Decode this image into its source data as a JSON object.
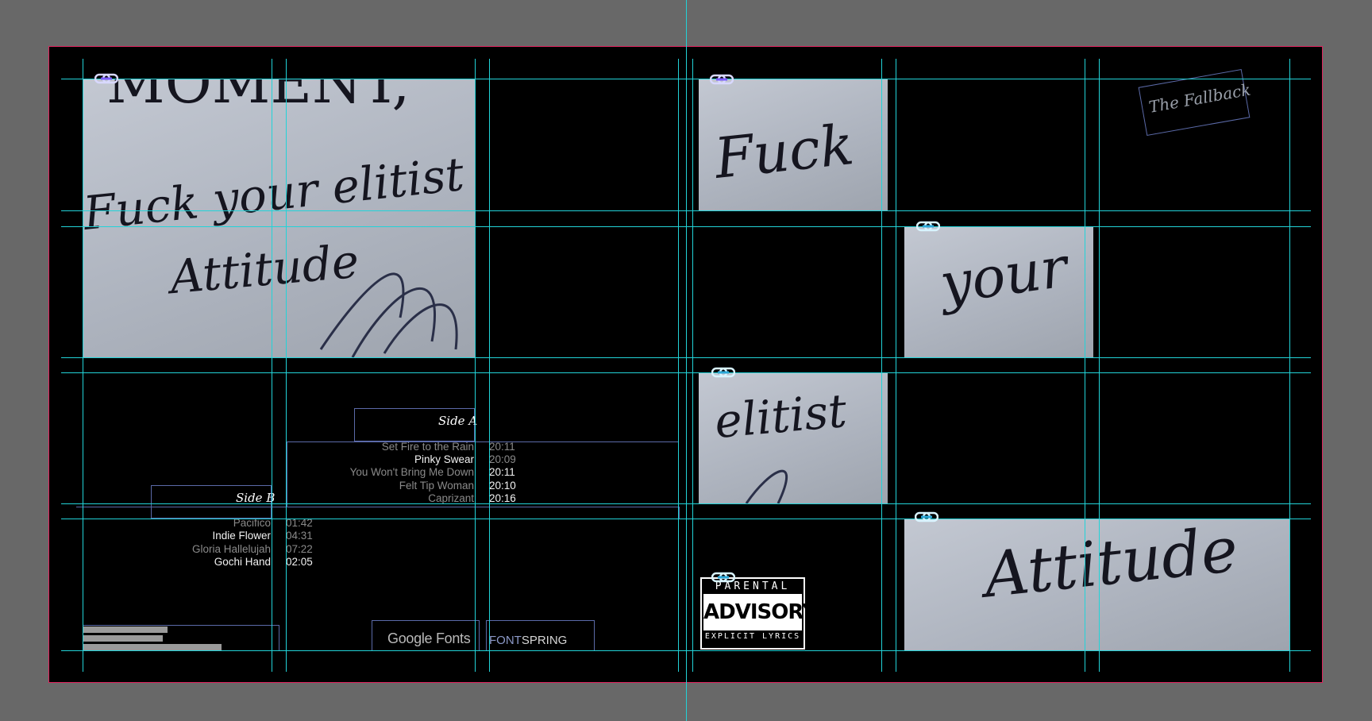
{
  "document": {
    "id": "album-spread"
  },
  "photos": {
    "cover_main": {
      "lines": [
        "MOMENT,",
        "Fuck your elitist",
        "Attitude"
      ]
    },
    "fuck": {
      "text": "Fuck"
    },
    "your": {
      "text": "your"
    },
    "elitist": {
      "text": "elitist"
    },
    "attitude": {
      "text": "Attitude"
    }
  },
  "band_tag": {
    "text": "The Fallback"
  },
  "side_a": {
    "label": "Side A",
    "tracks": [
      {
        "title": "Set Fire to the Rain",
        "time": "20:11"
      },
      {
        "title": "Pinky Swear",
        "time": "20:09"
      },
      {
        "title": "You Won't Bring Me Down",
        "time": "20:11"
      },
      {
        "title": "Felt Tip Woman",
        "time": "20:10"
      },
      {
        "title": "Caprizant",
        "time": "20:16"
      }
    ]
  },
  "side_b": {
    "label": "Side B",
    "tracks": [
      {
        "title": "Pacifico",
        "time": "01:42"
      },
      {
        "title": "Indie Flower",
        "time": "04:31"
      },
      {
        "title": "Gloria Hallelujah",
        "time": "07:22"
      },
      {
        "title": "Gochi Hand",
        "time": "02:05"
      }
    ]
  },
  "logos": {
    "google_fonts": "Google Fonts",
    "fontspring_a": "FONT",
    "fontspring_b": "SPRING"
  },
  "advisory": {
    "top": "PARENTAL",
    "mid": "ADVISORY",
    "bottom": "EXPLICIT LYRICS"
  },
  "colors": {
    "guide": "#22d3d8",
    "margin": "#9b3ce0",
    "bleed": "#e0245e",
    "frame": "#5b6aa8",
    "pasteboard": "#686868"
  },
  "icons": [
    "link-icon"
  ]
}
